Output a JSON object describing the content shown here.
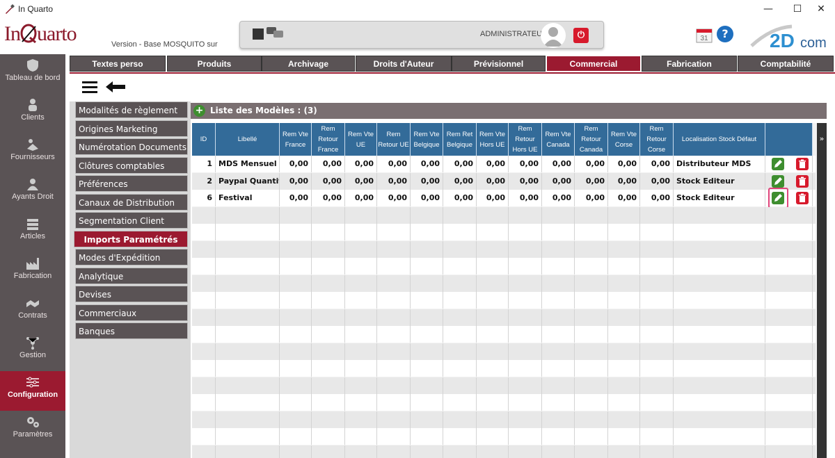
{
  "window": {
    "title": "In Quarto",
    "minimize": "—",
    "maximize": "☐",
    "close": "✕"
  },
  "header": {
    "logo_text_1": "In",
    "logo_text_2": "uarto",
    "version": "Version  - Base MOSQUITO sur",
    "user": "ADMINISTRATEUR",
    "power": "⏻",
    "calendar_day": "31",
    "help": "?",
    "brand_text": "com"
  },
  "sidebar": {
    "items": [
      {
        "label": "Tableau de bord",
        "icon": "shield-icon"
      },
      {
        "label": "Clients",
        "icon": "clients-icon"
      },
      {
        "label": "Fournisseurs",
        "icon": "supplier-icon"
      },
      {
        "label": "Ayants Droit",
        "icon": "person-icon"
      },
      {
        "label": "Articles",
        "icon": "books-icon"
      },
      {
        "label": "Fabrication",
        "icon": "factory-icon"
      },
      {
        "label": "Contrats",
        "icon": "handshake-icon"
      },
      {
        "label": "Gestion",
        "icon": "network-icon"
      },
      {
        "label": "Configuration",
        "icon": "sliders-icon",
        "active": true
      },
      {
        "label": "Paramètres",
        "icon": "gears-icon"
      }
    ]
  },
  "tabs": [
    {
      "label": "Textes perso"
    },
    {
      "label": "Produits"
    },
    {
      "label": "Archivage"
    },
    {
      "label": "Droits d'Auteur"
    },
    {
      "label": "Prévisionnel"
    },
    {
      "label": "Commercial",
      "active": true
    },
    {
      "label": "Fabrication"
    },
    {
      "label": "Comptabilité"
    }
  ],
  "leftmenu": {
    "items": [
      {
        "label": "Modalités de règlement"
      },
      {
        "label": "Origines Marketing"
      },
      {
        "label": "Numérotation Documents"
      },
      {
        "label": "Clôtures comptables"
      },
      {
        "label": "Préférences"
      },
      {
        "label": "Canaux de Distribution"
      },
      {
        "label": "Segmentation Client"
      },
      {
        "label": "Imports Paramétrés",
        "active": true
      },
      {
        "label": "Modes d'Expédition"
      },
      {
        "label": "Analytique"
      },
      {
        "label": "Devises"
      },
      {
        "label": "Commerciaux"
      },
      {
        "label": "Banques"
      }
    ]
  },
  "list": {
    "title": "Liste des Modèles : (3)",
    "add_label": "+",
    "columns": [
      "ID",
      "Libellé",
      "Rem Vte France",
      "Rem Retour France",
      "Rem Vte UE",
      "Rem Retour UE",
      "Rem Vte Belgique",
      "Rem Ret Belgique",
      "Rem Vte Hors UE",
      "Rem Retour Hors UE",
      "Rem Vte Canada",
      "Rem Retour Canada",
      "Rem Vte Corse",
      "Rem Retour Corse",
      "Localisation Stock Défaut"
    ],
    "rows": [
      {
        "id": "1",
        "libelle": "MDS Mensuel",
        "values": [
          "0,00",
          "0,00",
          "0,00",
          "0,00",
          "0,00",
          "0,00",
          "0,00",
          "0,00",
          "0,00",
          "0,00",
          "0,00",
          "0,00"
        ],
        "stock": "Distributeur MDS"
      },
      {
        "id": "2",
        "libelle": "Paypal Quantité",
        "values": [
          "0,00",
          "0,00",
          "0,00",
          "0,00",
          "0,00",
          "0,00",
          "0,00",
          "0,00",
          "0,00",
          "0,00",
          "0,00",
          "0,00"
        ],
        "stock": "Stock Editeur"
      },
      {
        "id": "6",
        "libelle": "Festival",
        "values": [
          "0,00",
          "0,00",
          "0,00",
          "0,00",
          "0,00",
          "0,00",
          "0,00",
          "0,00",
          "0,00",
          "0,00",
          "0,00",
          "0,00"
        ],
        "stock": "Stock Editeur"
      }
    ],
    "scroll_chevron": "»"
  },
  "colors": {
    "accent": "#9b1a30",
    "sidebar": "#5a5355",
    "grid_header": "#336b99",
    "edit": "#3e8e2f",
    "delete": "#d71a2c",
    "highlight": "#e0457b"
  }
}
